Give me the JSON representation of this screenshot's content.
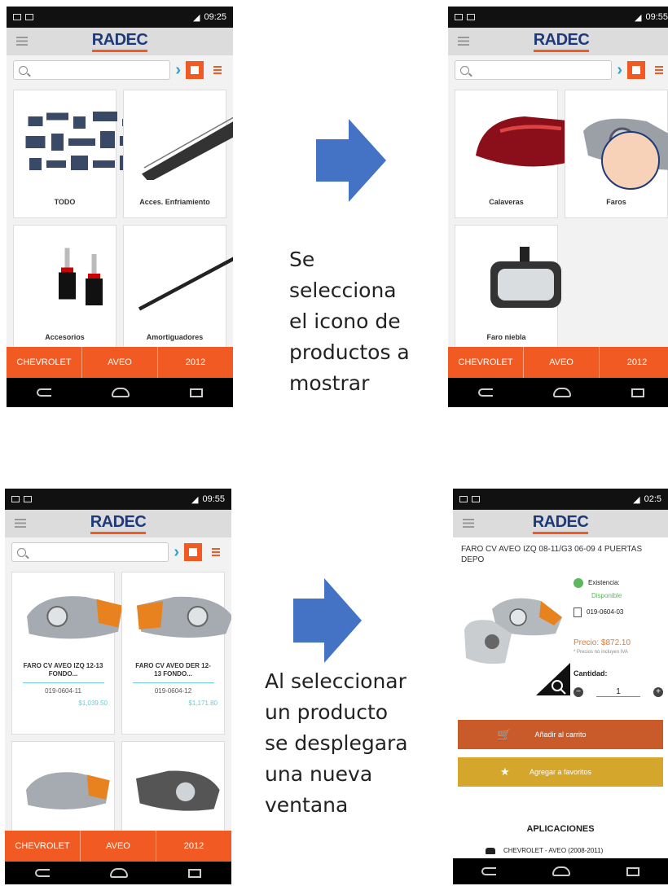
{
  "app": {
    "logo": "RADEC"
  },
  "screen1": {
    "time": "09:25",
    "cards": [
      {
        "label": "TODO"
      },
      {
        "label": "Acces. Enfriamiento"
      },
      {
        "label": "Accesorios"
      },
      {
        "label": "Amortiguadores"
      }
    ]
  },
  "screen2": {
    "time": "09:55",
    "cards": [
      {
        "label": "Calaveras"
      },
      {
        "label": "Faros"
      },
      {
        "label": "Faro niebla"
      }
    ]
  },
  "screen3": {
    "time": "09:55",
    "cards": [
      {
        "label": "FARO CV AVEO IZQ 12-13 FONDO...",
        "code": "019-0604-11",
        "price": "$1,039.50"
      },
      {
        "label": "FARO CV AVEO DER 12-13 FONDO...",
        "code": "019-0604-12",
        "price": "$1,171.80"
      }
    ]
  },
  "screen4": {
    "time": "02:5",
    "title": "FARO CV AVEO IZQ 08-11/G3 06-09 4 PUERTAS DEPO",
    "stock_label": "Existencia:",
    "stock_value": "Disponible",
    "sku": "019-0604-03",
    "price": "Precio: $872.10",
    "price_note": "* Precios no incluyen IVA",
    "qty_label": "Cantidad:",
    "qty_value": "1",
    "add_to_cart": "Añadir al carrito",
    "add_to_favorites": "Agregar a favoritos",
    "applications_title": "APLICACIONES",
    "application_1": "CHEVROLET - AVEO (2008-2011)"
  },
  "vehicle": {
    "make": "CHEVROLET",
    "model": "AVEO",
    "year": "2012"
  },
  "captions": {
    "top": "Se\nselecciona\nel icono de\nproductos a\nmostrar",
    "bottom": "Al seleccionar\nun producto\nse desplegara\nuna nueva\nventana"
  },
  "colors": {
    "orange": "#f15a22",
    "mustard": "#d4a72c",
    "rust": "#c95a2a",
    "arrow": "#4472c4",
    "green": "#5cb85c",
    "link": "#2a9fd6"
  }
}
